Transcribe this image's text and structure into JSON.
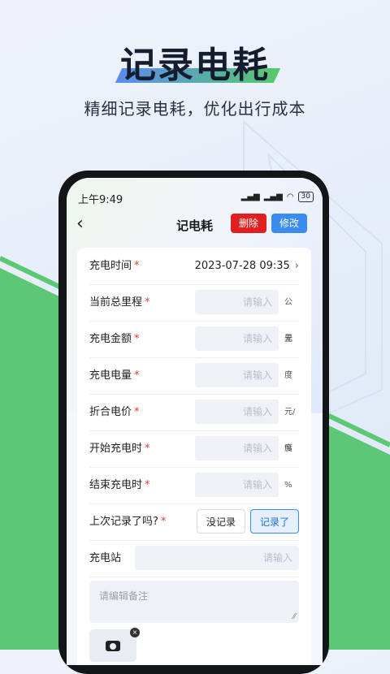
{
  "banner": {
    "title": "记录电耗",
    "subtitle": "精细记录电耗，优化出行成本"
  },
  "colors": {
    "green": "#5cc774",
    "blue_accent": "#3b8cf0",
    "danger": "#e02020"
  },
  "status_bar": {
    "time": "上午9:49",
    "battery": "30"
  },
  "nav": {
    "back_icon": "chevron-left-icon",
    "title": "记电耗",
    "delete_label": "删除",
    "edit_label": "修改"
  },
  "form": {
    "required_mark": "*",
    "charge_time": {
      "label": "充电时间",
      "value": "2023-07-28  09:35"
    },
    "total_mileage": {
      "label": "当前总里程",
      "placeholder": "请输入",
      "unit": "公里"
    },
    "charge_amount": {
      "label": "充电金额",
      "placeholder": "请输入",
      "unit": "元"
    },
    "charge_energy": {
      "label": "充电电量",
      "placeholder": "请输入",
      "unit": "度"
    },
    "unit_price": {
      "label": "折合电价",
      "placeholder": "请输入",
      "unit": "元/度"
    },
    "start_soc": {
      "label": "开始充电时",
      "placeholder": "请输入",
      "unit": "%"
    },
    "end_soc": {
      "label": "结束充电时",
      "placeholder": "请输入",
      "unit": "%"
    },
    "last_recorded": {
      "label": "上次记录了吗?",
      "option_no": "没记录",
      "option_yes": "记录了",
      "selected": "记录了"
    },
    "station": {
      "label": "充电站",
      "placeholder": "请输入"
    },
    "notes_placeholder": "请编辑备注"
  }
}
